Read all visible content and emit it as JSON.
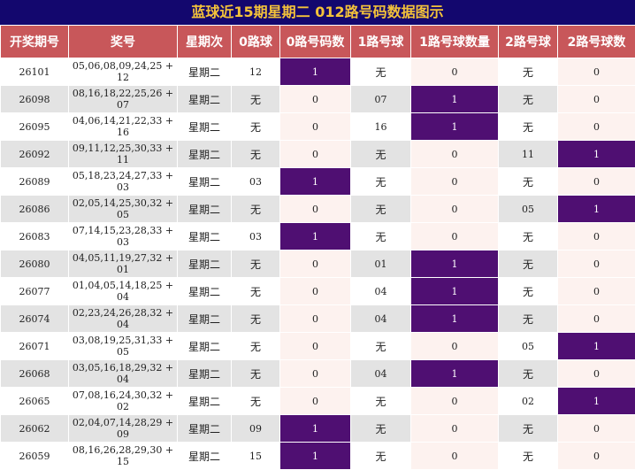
{
  "title": "蓝球近15期星期二 012路号码数据图示",
  "headers": [
    "开奖期号",
    "奖号",
    "星期次",
    "0路球",
    "0路号码数",
    "1路号球",
    "1路号球数量",
    "2路号球",
    "2路号球数"
  ],
  "colors": {
    "title_bg": "#13076e",
    "title_fg": "#f3c23a",
    "header_bg": "#c8575a",
    "hit_bg": "#4f0f72",
    "pale_bg": "#fdf2ef",
    "row_alt": "#e3e3e3"
  },
  "chart_data": {
    "type": "table",
    "title": "蓝球近15期星期二 012路号码数据图示",
    "columns": [
      "开奖期号",
      "奖号",
      "星期次",
      "0路球",
      "0路号码数",
      "1路号球",
      "1路号球数量",
      "2路号球",
      "2路号球数"
    ],
    "rows": [
      [
        "26101",
        "05,06,08,09,24,25 + 12",
        "星期二",
        "12",
        "1",
        "无",
        "0",
        "无",
        "0"
      ],
      [
        "26098",
        "08,16,18,22,25,26 + 07",
        "星期二",
        "无",
        "0",
        "07",
        "1",
        "无",
        "0"
      ],
      [
        "26095",
        "04,06,14,21,22,33 + 16",
        "星期二",
        "无",
        "0",
        "16",
        "1",
        "无",
        "0"
      ],
      [
        "26092",
        "09,11,12,25,30,33 + 11",
        "星期二",
        "无",
        "0",
        "无",
        "0",
        "11",
        "1"
      ],
      [
        "26089",
        "05,18,23,24,27,33 + 03",
        "星期二",
        "03",
        "1",
        "无",
        "0",
        "无",
        "0"
      ],
      [
        "26086",
        "02,05,14,25,30,32 + 05",
        "星期二",
        "无",
        "0",
        "无",
        "0",
        "05",
        "1"
      ],
      [
        "26083",
        "07,14,15,23,28,33 + 03",
        "星期二",
        "03",
        "1",
        "无",
        "0",
        "无",
        "0"
      ],
      [
        "26080",
        "04,05,11,19,27,32 + 01",
        "星期二",
        "无",
        "0",
        "01",
        "1",
        "无",
        "0"
      ],
      [
        "26077",
        "01,04,05,14,18,25 + 04",
        "星期二",
        "无",
        "0",
        "04",
        "1",
        "无",
        "0"
      ],
      [
        "26074",
        "02,23,24,26,28,32 + 04",
        "星期二",
        "无",
        "0",
        "04",
        "1",
        "无",
        "0"
      ],
      [
        "26071",
        "03,08,19,25,31,33 + 05",
        "星期二",
        "无",
        "0",
        "无",
        "0",
        "05",
        "1"
      ],
      [
        "26068",
        "03,05,16,18,29,32 + 04",
        "星期二",
        "无",
        "0",
        "04",
        "1",
        "无",
        "0"
      ],
      [
        "26065",
        "07,08,16,24,30,32 + 02",
        "星期二",
        "无",
        "0",
        "无",
        "0",
        "02",
        "1"
      ],
      [
        "26062",
        "02,04,07,14,28,29 + 09",
        "星期二",
        "09",
        "1",
        "无",
        "0",
        "无",
        "0"
      ],
      [
        "26059",
        "08,16,26,28,29,30 + 15",
        "星期二",
        "15",
        "1",
        "无",
        "0",
        "无",
        "0"
      ]
    ]
  }
}
